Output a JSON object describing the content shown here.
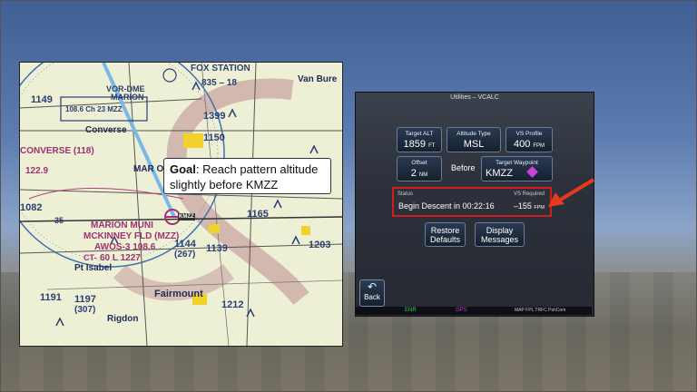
{
  "map": {
    "labels": [
      "FOX STATION",
      "835 – 18",
      "VOR-DME",
      "MARION",
      "108.6 Ch 23 MZZ",
      "1399",
      "Van Bure",
      "1149",
      "Converse",
      "1150",
      "CONVERSE (118)",
      "122.9",
      "MAR ON",
      "MARION MUNI",
      "KMZZ",
      "MCKINNEY FLD (MZZ)",
      "AWOS-3 108.6",
      "CT-",
      "60 L 1227",
      "1144",
      "(267)",
      "1139",
      "1165",
      "1203",
      "Pt Isabel",
      "1191",
      "1197",
      "(307)",
      "Fairmount",
      "1212",
      "Rigdon",
      "1082",
      "35"
    ],
    "callout": {
      "title": "Goal",
      "text": ": Reach pattern altitude slightly before KMZZ"
    }
  },
  "gtn": {
    "title": "Utilities – VCALC",
    "target_alt": {
      "caption": "Target ALT",
      "value": "1859",
      "unit": "FT"
    },
    "altitude_type": {
      "caption": "Altitude Type",
      "value": "MSL"
    },
    "vs_profile": {
      "caption": "VS Profile",
      "value": "400",
      "unit": "FPM"
    },
    "offset": {
      "caption": "Offset",
      "value": "2",
      "unit": "NM"
    },
    "before": "Before",
    "target_waypoint": {
      "caption": "Target Waypoint",
      "value": "KMZZ"
    },
    "status_label": "Status",
    "vs_required_label": "VS Required",
    "status_text": "Begin Descent in 00:22:16",
    "vs_required": "–155",
    "vs_unit": "FPM",
    "restore_defaults": "Restore\nDefaults",
    "display_messages": "Display\nMessages",
    "back": "Back",
    "mode_enr": "ENR",
    "mode_gps": "GPS",
    "bottom_right": "MAP FPL TRFC PshCom"
  },
  "colors": {
    "status_border": "#d21c1c",
    "arrow": "#e8391f",
    "route_line": "#7bb8e8"
  }
}
